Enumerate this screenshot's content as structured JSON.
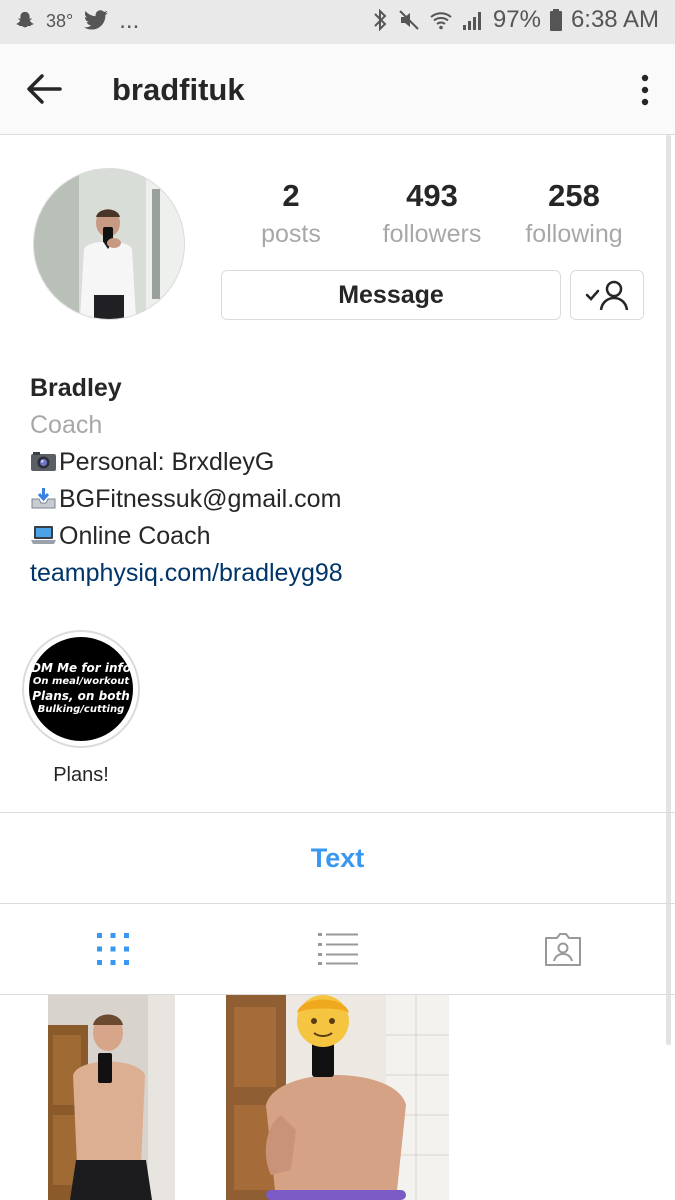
{
  "status_bar": {
    "temperature": "38°",
    "more": "...",
    "battery": "97%",
    "time": "6:38 AM"
  },
  "nav": {
    "username": "bradfituk"
  },
  "stats": [
    {
      "value": "2",
      "label": "posts"
    },
    {
      "value": "493",
      "label": "followers"
    },
    {
      "value": "258",
      "label": "following"
    }
  ],
  "actions": {
    "message_label": "Message"
  },
  "bio": {
    "name": "Bradley",
    "category": "Coach",
    "lines": [
      {
        "emoji": "camera-icon",
        "text": "Personal: BrxdleyG"
      },
      {
        "emoji": "inbox-tray-icon",
        "text": "BGFitnessuk@gmail.com"
      },
      {
        "emoji": "laptop-icon",
        "text": "Online Coach"
      }
    ],
    "link": "teamphysiq.com/bradleyg98"
  },
  "highlight": {
    "cover_text": [
      "DM Me for info",
      "On meal/workout",
      "Plans, on both",
      "Bulking/cutting"
    ],
    "label": "Plans!"
  },
  "text_button": "Text",
  "tabs": [
    {
      "icon": "grid-icon",
      "active": true
    },
    {
      "icon": "list-icon",
      "active": false
    },
    {
      "icon": "tagged-icon",
      "active": false
    }
  ],
  "colors": {
    "accent": "#3897f0",
    "link": "#003569",
    "muted": "#a8a8a8",
    "border": "#dbdbdb"
  }
}
